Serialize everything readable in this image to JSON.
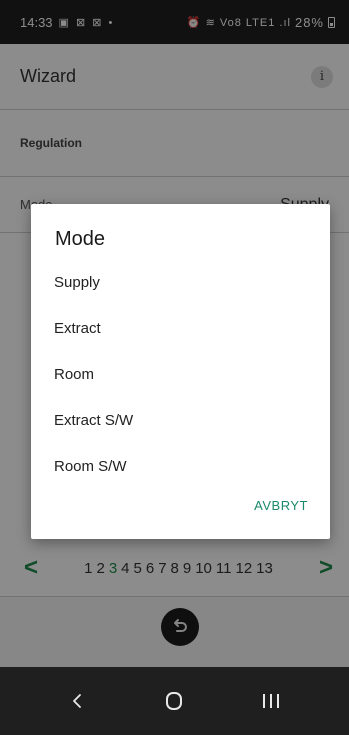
{
  "status_bar": {
    "time": "14:33",
    "left_icons": "▣ ⊠ ⊠ •",
    "right_icons": "⏰ ≋ Vo8 LTE1 .ıl",
    "battery": "28%"
  },
  "header": {
    "title": "Wizard",
    "info_label": "i"
  },
  "section": {
    "title": "Regulation"
  },
  "mode_row": {
    "label": "Mode",
    "value": "Supply"
  },
  "dialog": {
    "title": "Mode",
    "options": [
      "Supply",
      "Extract",
      "Room",
      "Extract S/W",
      "Room S/W"
    ],
    "cancel_label": "AVBRYT"
  },
  "pager": {
    "prev": "<",
    "next": ">",
    "pages": [
      "1",
      "2",
      "3",
      "4",
      "5",
      "6",
      "7",
      "8",
      "9",
      "10",
      "11",
      "12",
      "13"
    ],
    "current": "3"
  },
  "colors": {
    "accent_green": "#1e8a4a",
    "dialog_button": "#1a8a6a"
  },
  "icons": {
    "info": "info-icon",
    "back_fab": "undo-arrow-icon",
    "nav_back": "chevron-left-icon",
    "nav_home": "home-icon",
    "nav_recents": "recents-icon"
  }
}
